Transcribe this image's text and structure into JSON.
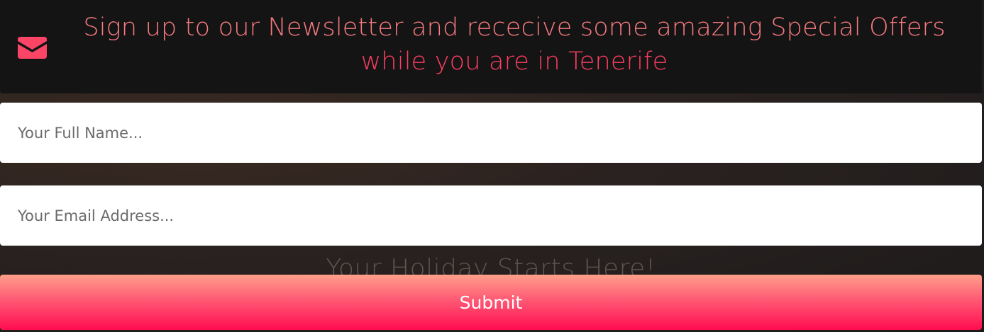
{
  "newsletter": {
    "icon": "envelope-icon",
    "headline_line1": "Sign up to our Newsletter and rececive some amazing Special Offers",
    "headline_line2": "while you are in Tenerife",
    "accent_colors": [
      "#f77a80",
      "#fb3d62"
    ]
  },
  "form": {
    "name_placeholder": "Your Full Name...",
    "email_placeholder": "Your Email Address...",
    "submit_label": "Submit",
    "submit_gradient": [
      "#ff9f8a",
      "#ff0d4f"
    ]
  },
  "background": {
    "tagline": "Your Holiday Starts Here!"
  }
}
